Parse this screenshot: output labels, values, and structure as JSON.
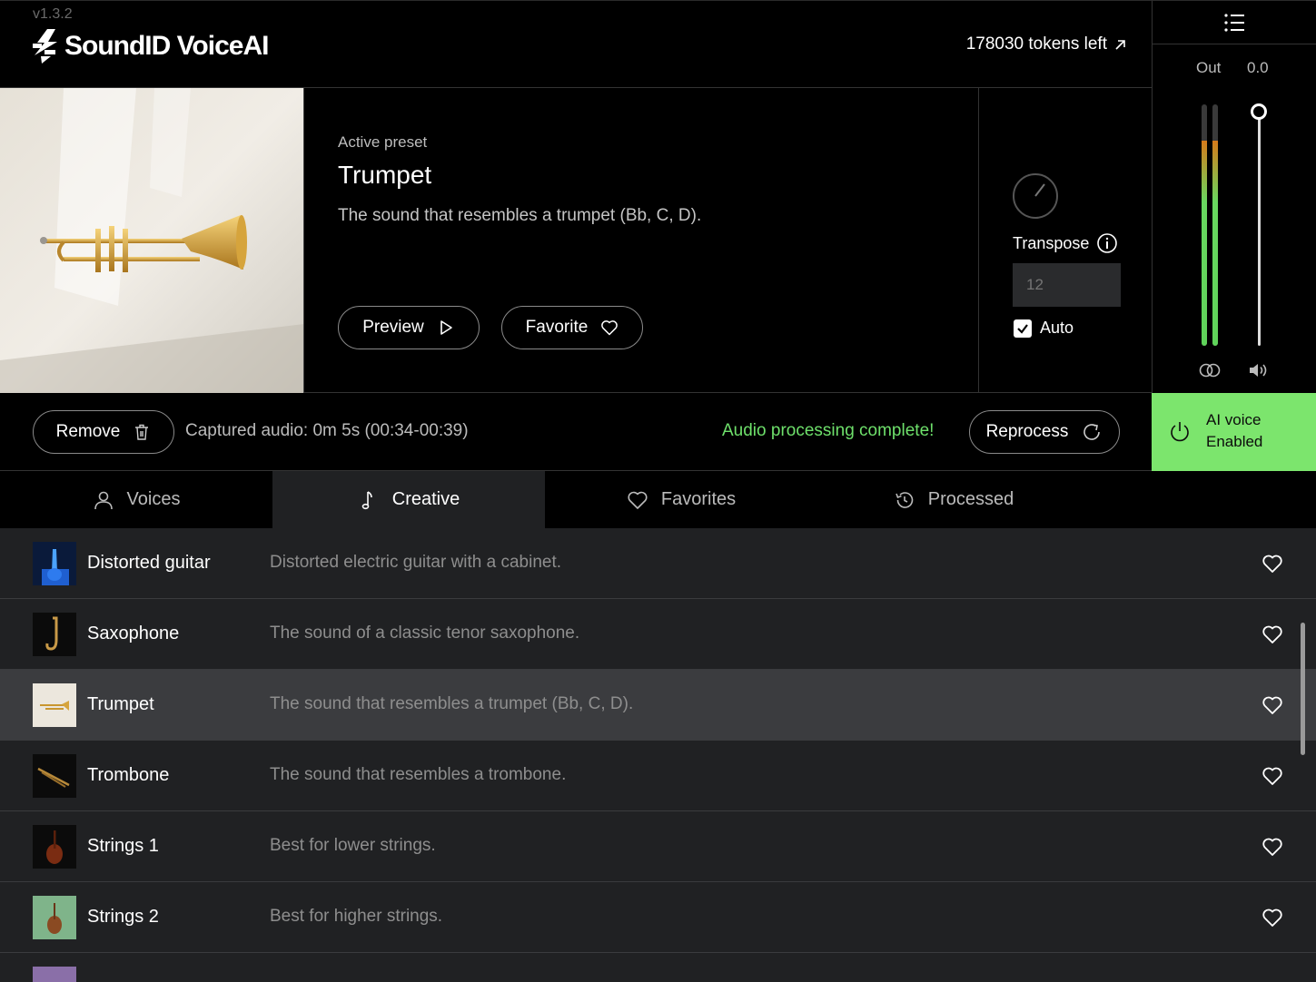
{
  "app": {
    "version": "v1.3.2",
    "name": "SoundID VoiceAI",
    "tokens_label": "178030 tokens left"
  },
  "output": {
    "label": "Out",
    "value": "0.0",
    "meter_left_level": 0.85,
    "meter_right_level": 0.85
  },
  "preset": {
    "active_label": "Active preset",
    "title": "Trumpet",
    "description": "The sound that resembles a trumpet (Bb, C, D).",
    "preview_label": "Preview",
    "favorite_label": "Favorite"
  },
  "transpose": {
    "label": "Transpose",
    "placeholder": "12",
    "auto_label": "Auto",
    "auto_checked": true
  },
  "status": {
    "remove_label": "Remove",
    "captured_text": "Captured audio: 0m 5s (00:34-00:39)",
    "complete_text": "Audio processing complete!",
    "reprocess_label": "Reprocess"
  },
  "ai_voice": {
    "line1": "AI voice",
    "line2": "Enabled"
  },
  "tabs": [
    {
      "label": "Voices",
      "icon": "person-icon",
      "active": false
    },
    {
      "label": "Creative",
      "icon": "music-note-icon",
      "active": true
    },
    {
      "label": "Favorites",
      "icon": "heart-icon",
      "active": false
    },
    {
      "label": "Processed",
      "icon": "history-icon",
      "active": false
    }
  ],
  "list": [
    {
      "name": "Distorted guitar",
      "description": "Distorted electric guitar with a cabinet.",
      "selected": false
    },
    {
      "name": "Saxophone",
      "description": "The sound of a classic tenor saxophone.",
      "selected": false
    },
    {
      "name": "Trumpet",
      "description": "The sound that resembles a trumpet (Bb, C, D).",
      "selected": true
    },
    {
      "name": "Trombone",
      "description": "The sound that resembles a trombone.",
      "selected": false
    },
    {
      "name": "Strings 1",
      "description": "Best for lower strings.",
      "selected": false
    },
    {
      "name": "Strings 2",
      "description": "Best for higher strings.",
      "selected": false
    }
  ],
  "colors": {
    "accent_green": "#7ce56d",
    "complete_green": "#6ee06b",
    "list_bg": "#202123",
    "selected_row": "#3b3c3f"
  }
}
